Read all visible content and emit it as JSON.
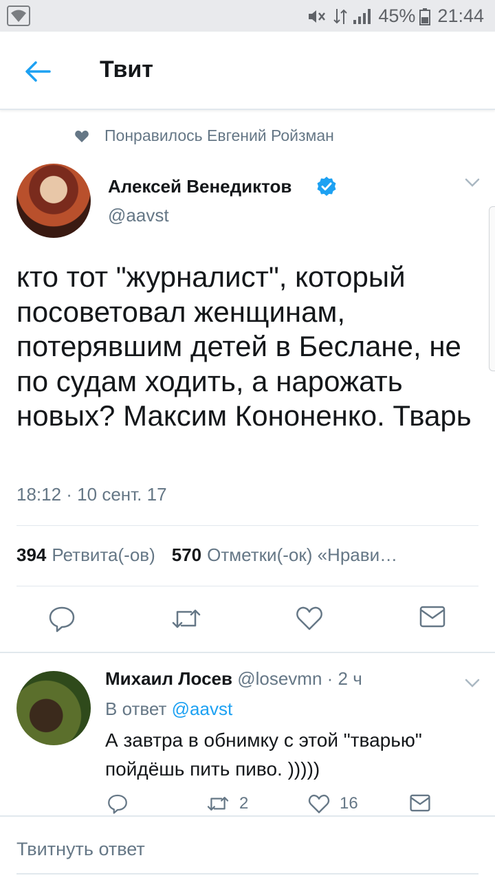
{
  "status_bar": {
    "battery": "45%",
    "time": "21:44"
  },
  "header": {
    "title": "Твит"
  },
  "liked_by": "Понравилось Евгений Ройзман",
  "tweet": {
    "author_name": "Алексей Венедиктов",
    "author_handle": "@aavst",
    "text": "кто тот \"журналист\", который посоветовал женщинам, потерявшим детей в Беслане, не по судам ходить, а нарожать новых? Максим Кононенко. Тварь",
    "timestamp": "18:12 · 10 сент. 17",
    "retweets_count": "394",
    "retweets_label": "Ретвита(-ов)",
    "likes_count": "570",
    "likes_label": "Отметки(-ок) «Нрави…"
  },
  "reply": {
    "author_name": "Михаил Лосев",
    "author_handle": "@losevmn",
    "time": "· 2 ч",
    "reply_to_prefix": "В ответ",
    "reply_to_handle": "@aavst",
    "text": "А завтра в обнимку с этой \"тварью\" пойдёшь пить пиво. )))))",
    "retweets": "2",
    "likes": "16"
  },
  "compose": {
    "placeholder": "Твитнуть ответ"
  },
  "colors": {
    "accent": "#1da1f2",
    "secondary_text": "#657786",
    "icon": "#657786"
  }
}
